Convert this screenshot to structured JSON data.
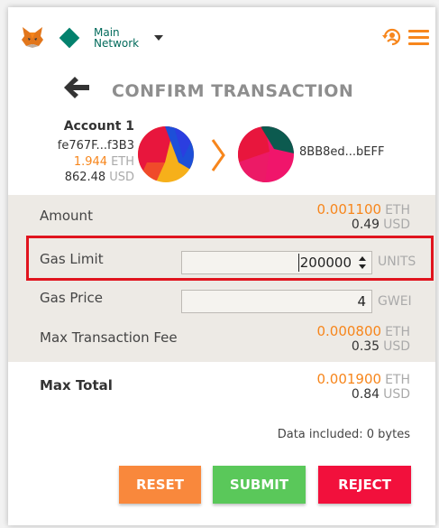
{
  "header": {
    "network_line1": "Main",
    "network_line2": "Network"
  },
  "title": "CONFIRM TRANSACTION",
  "from_account": {
    "name": "Account 1",
    "address": "fe767F...f3B3",
    "balance_eth": "1.944",
    "balance_eth_unit": "ETH",
    "balance_usd": "862.48",
    "balance_usd_unit": "USD"
  },
  "to_account": {
    "address": "8BB8ed...bEFF"
  },
  "details": {
    "amount": {
      "label": "Amount",
      "eth": "0.001100",
      "eth_unit": "ETH",
      "usd": "0.49",
      "usd_unit": "USD"
    },
    "gas_limit": {
      "label": "Gas Limit",
      "value": "200000",
      "unit": "UNITS"
    },
    "gas_price": {
      "label": "Gas Price",
      "value": "4",
      "unit": "GWEI"
    },
    "max_fee": {
      "label": "Max Transaction Fee",
      "eth": "0.000800",
      "eth_unit": "ETH",
      "usd": "0.35",
      "usd_unit": "USD"
    }
  },
  "total": {
    "label": "Max Total",
    "eth": "0.001900",
    "eth_unit": "ETH",
    "usd": "0.84",
    "usd_unit": "USD"
  },
  "data_included": "Data included: 0 bytes",
  "buttons": {
    "reset": "RESET",
    "submit": "SUBMIT",
    "reject": "REJECT"
  },
  "colors": {
    "accent": "#f7861c",
    "network": "#03816d",
    "highlight": "#e0141e",
    "reset": "#f9883c",
    "submit": "#5ac85a",
    "reject": "#f2103c"
  }
}
